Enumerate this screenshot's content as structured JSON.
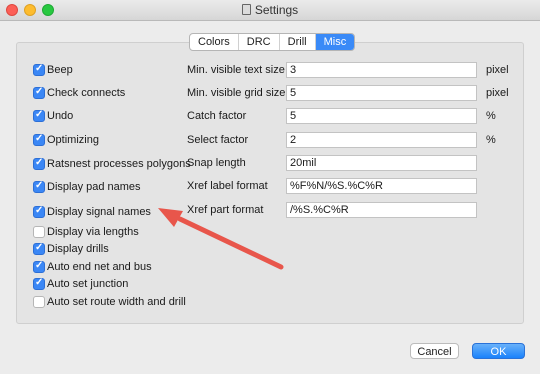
{
  "window": {
    "title": "Settings"
  },
  "tabs": [
    {
      "label": "Colors"
    },
    {
      "label": "DRC"
    },
    {
      "label": "Drill"
    },
    {
      "label": "Misc",
      "active": true
    }
  ],
  "checkboxes": [
    {
      "label": "Beep",
      "checked": true
    },
    {
      "label": "Check connects",
      "checked": true
    },
    {
      "label": "Undo",
      "checked": true
    },
    {
      "label": "Optimizing",
      "checked": true
    },
    {
      "label": "Ratsnest processes polygons",
      "checked": true
    },
    {
      "label": "Display pad names",
      "checked": true
    },
    {
      "label": "Display signal names",
      "checked": true
    },
    {
      "label": "Display via lengths",
      "checked": false
    },
    {
      "label": "Display drills",
      "checked": true
    },
    {
      "label": "Auto end net and bus",
      "checked": true
    },
    {
      "label": "Auto set junction",
      "checked": true
    },
    {
      "label": "Auto set route width and drill",
      "checked": false
    }
  ],
  "fields": [
    {
      "label": "Min. visible text size",
      "value": "3",
      "unit": "pixel"
    },
    {
      "label": "Min. visible grid size",
      "value": "5",
      "unit": "pixel"
    },
    {
      "label": "Catch factor",
      "value": "5",
      "unit": "%"
    },
    {
      "label": "Select factor",
      "value": "2",
      "unit": "%"
    },
    {
      "label": "Snap length",
      "value": "20mil",
      "unit": ""
    },
    {
      "label": "Xref label format",
      "value": "%F%N/%S.%C%R",
      "unit": ""
    },
    {
      "label": "Xref part format",
      "value": "/%S.%C%R",
      "unit": ""
    }
  ],
  "buttons": {
    "cancel": "Cancel",
    "ok": "OK"
  },
  "colors": {
    "accent": "#3a8af7",
    "annotation_arrow": "#e8564b"
  }
}
